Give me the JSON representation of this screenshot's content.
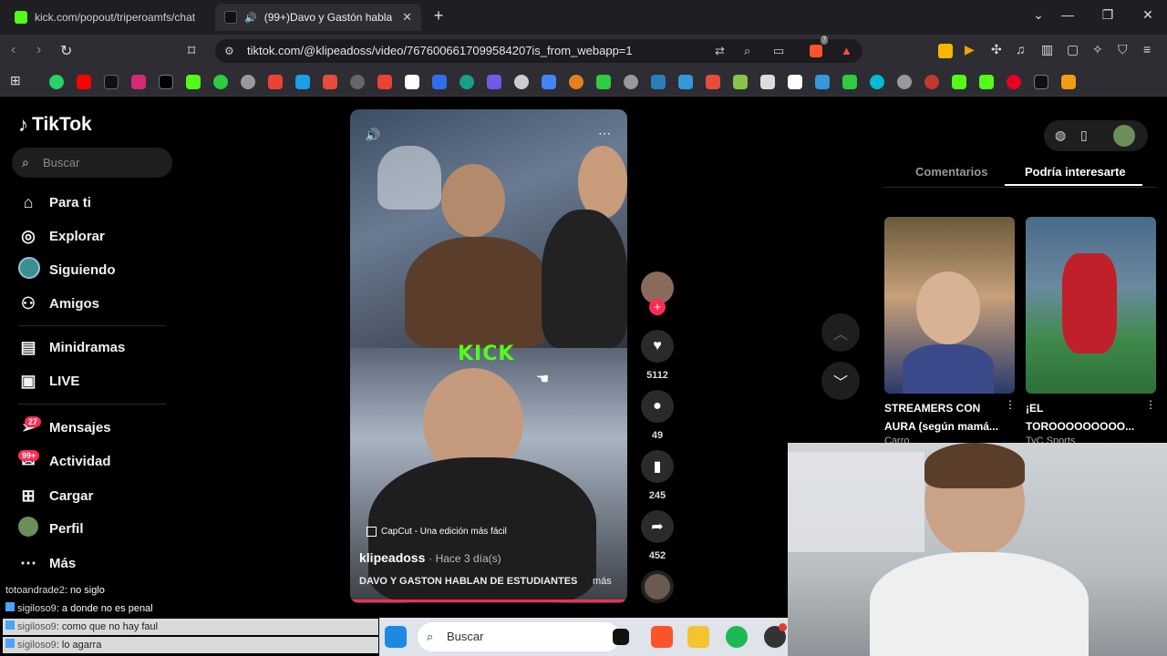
{
  "browser": {
    "tabs": [
      {
        "title": "kick.com/popout/triperoamfs/chat"
      },
      {
        "title": "(99+)Davo y Gastón hablan d"
      }
    ],
    "url": "tiktok.com/@klipeadoss/video/7676006617099584207is_from_webapp=1",
    "extension_badge": "7"
  },
  "tiktok": {
    "logo": "TikTok",
    "search_placeholder": "Buscar",
    "nav": [
      {
        "label": "Para ti",
        "icon": "home-icon"
      },
      {
        "label": "Explorar",
        "icon": "compass-icon"
      },
      {
        "label": "Siguiendo",
        "icon": "avatar-icon"
      },
      {
        "label": "Amigos",
        "icon": "friends-icon"
      },
      {
        "label": "Minidramas",
        "icon": "film-icon"
      },
      {
        "label": "LIVE",
        "icon": "live-icon"
      },
      {
        "label": "Mensajes",
        "icon": "send-icon",
        "badge": "27"
      },
      {
        "label": "Actividad",
        "icon": "inbox-icon",
        "badge": "99+"
      },
      {
        "label": "Cargar",
        "icon": "upload-icon"
      },
      {
        "label": "Perfil",
        "icon": "profile-icon"
      },
      {
        "label": "Más",
        "icon": "more-icon"
      }
    ],
    "video": {
      "overlay_logo": "KICK",
      "capcut": "CapCut - Una edición más fácil",
      "author": "klipeadoss",
      "posted": "· Hace 3 día(s)",
      "title": "DAVO Y GASTON HABLAN DE ESTUDIANTES",
      "more": "más"
    },
    "actions": {
      "likes": "5112",
      "comments": "49",
      "saves": "245",
      "shares": "452"
    },
    "right_tabs": [
      "Comentarios",
      "Podría interesarte"
    ],
    "suggested": [
      {
        "title": "STREAMERS CON AURA (según mamá...",
        "author": "Carro"
      },
      {
        "title": "¡EL TOROOOOOOOOO...",
        "author": "TyC Sports"
      }
    ]
  },
  "chat": [
    {
      "user": "totoandrade2",
      "text": ": no siglo"
    },
    {
      "user": "sigiloso9",
      "text": ": a donde no es penal"
    },
    {
      "user": "sigiloso9",
      "text": ": como que no hay faul"
    },
    {
      "user": "sigiloso9",
      "text": ": lo agarra"
    }
  ],
  "taskbar": {
    "search_placeholder": "Buscar"
  },
  "colors": {
    "tiktok_red": "#fe2c55",
    "kick_green": "#53fc18"
  }
}
